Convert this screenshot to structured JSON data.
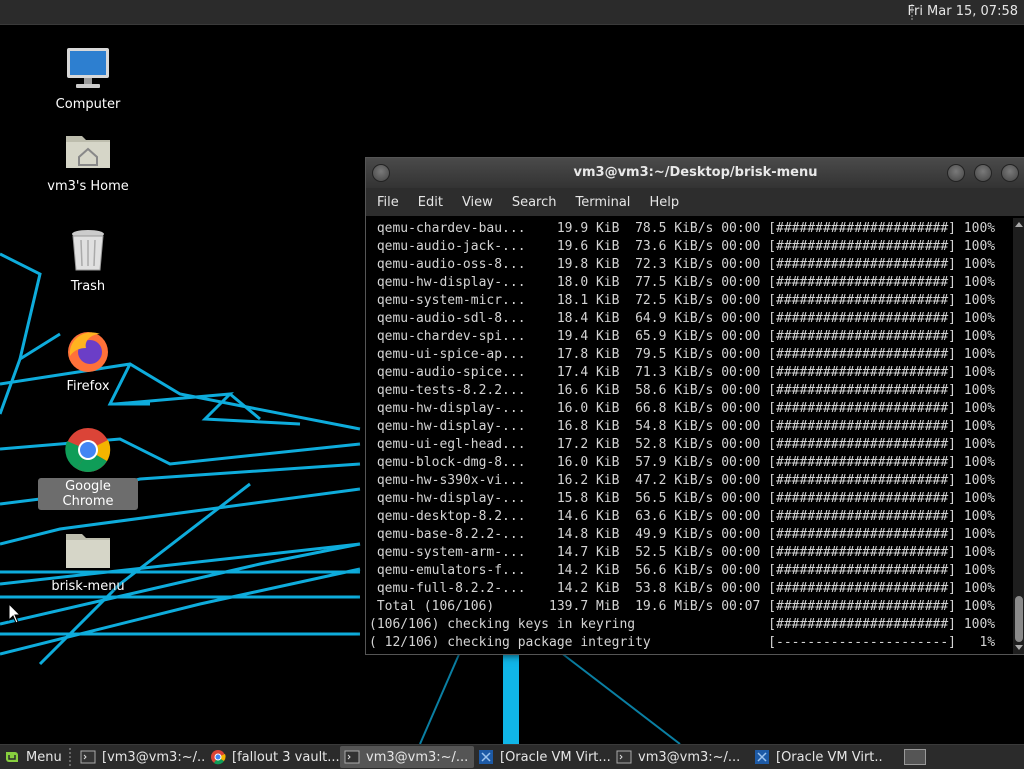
{
  "top_panel": {
    "clock": "Fri Mar 15, 07:58"
  },
  "desktop": {
    "icons": [
      {
        "label": "Computer",
        "icon": "computer-icon"
      },
      {
        "label": "vm3's Home",
        "icon": "home-folder-icon"
      },
      {
        "label": "Trash",
        "icon": "trash-icon"
      },
      {
        "label": "Firefox",
        "icon": "firefox-icon"
      },
      {
        "label": "Google Chrome",
        "icon": "chrome-icon",
        "selected": true
      },
      {
        "label": "brisk-menu",
        "icon": "folder-icon"
      }
    ]
  },
  "terminal": {
    "title": "vm3@vm3:~/Desktop/brisk-menu",
    "menu": [
      "File",
      "Edit",
      "View",
      "Search",
      "Terminal",
      "Help"
    ],
    "lines": [
      " qemu-chardev-bau...    19.9 KiB  78.5 KiB/s 00:00 [######################] 100%",
      " qemu-audio-jack-...    19.6 KiB  73.6 KiB/s 00:00 [######################] 100%",
      " qemu-audio-oss-8...    19.8 KiB  72.3 KiB/s 00:00 [######################] 100%",
      " qemu-hw-display-...    18.0 KiB  77.5 KiB/s 00:00 [######################] 100%",
      " qemu-system-micr...    18.1 KiB  72.5 KiB/s 00:00 [######################] 100%",
      " qemu-audio-sdl-8...    18.4 KiB  64.9 KiB/s 00:00 [######################] 100%",
      " qemu-chardev-spi...    19.4 KiB  65.9 KiB/s 00:00 [######################] 100%",
      " qemu-ui-spice-ap...    17.8 KiB  79.5 KiB/s 00:00 [######################] 100%",
      " qemu-audio-spice...    17.4 KiB  71.3 KiB/s 00:00 [######################] 100%",
      " qemu-tests-8.2.2...    16.6 KiB  58.6 KiB/s 00:00 [######################] 100%",
      " qemu-hw-display-...    16.0 KiB  66.8 KiB/s 00:00 [######################] 100%",
      " qemu-hw-display-...    16.8 KiB  54.8 KiB/s 00:00 [######################] 100%",
      " qemu-ui-egl-head...    17.2 KiB  52.8 KiB/s 00:00 [######################] 100%",
      " qemu-block-dmg-8...    16.0 KiB  57.9 KiB/s 00:00 [######################] 100%",
      " qemu-hw-s390x-vi...    16.2 KiB  47.2 KiB/s 00:00 [######################] 100%",
      " qemu-hw-display-...    15.8 KiB  56.5 KiB/s 00:00 [######################] 100%",
      " qemu-desktop-8.2...    14.6 KiB  63.6 KiB/s 00:00 [######################] 100%",
      " qemu-base-8.2.2-...    14.8 KiB  49.9 KiB/s 00:00 [######################] 100%",
      " qemu-system-arm-...    14.7 KiB  52.5 KiB/s 00:00 [######################] 100%",
      " qemu-emulators-f...    14.2 KiB  56.6 KiB/s 00:00 [######################] 100%",
      " qemu-full-8.2.2-...    14.2 KiB  53.8 KiB/s 00:00 [######################] 100%",
      " Total (106/106)       139.7 MiB  19.6 MiB/s 00:07 [######################] 100%",
      "(106/106) checking keys in keyring                 [######################] 100%",
      "( 12/106) checking package integrity               [----------------------]   1%"
    ]
  },
  "taskbar": {
    "menu_label": "Menu",
    "tasks": [
      {
        "label": "[vm3@vm3:~/...",
        "icon": "terminal-icon",
        "active": false
      },
      {
        "label": "[fallout 3 vault...",
        "icon": "chrome-icon",
        "active": false
      },
      {
        "label": "vm3@vm3:~/...",
        "icon": "terminal-icon",
        "active": true
      },
      {
        "label": "[Oracle VM Virt...",
        "icon": "virtualbox-icon",
        "active": false
      },
      {
        "label": "vm3@vm3:~/...",
        "icon": "terminal-icon",
        "active": false
      },
      {
        "label": "[Oracle VM Virt...",
        "icon": "virtualbox-icon",
        "active": false
      }
    ]
  }
}
